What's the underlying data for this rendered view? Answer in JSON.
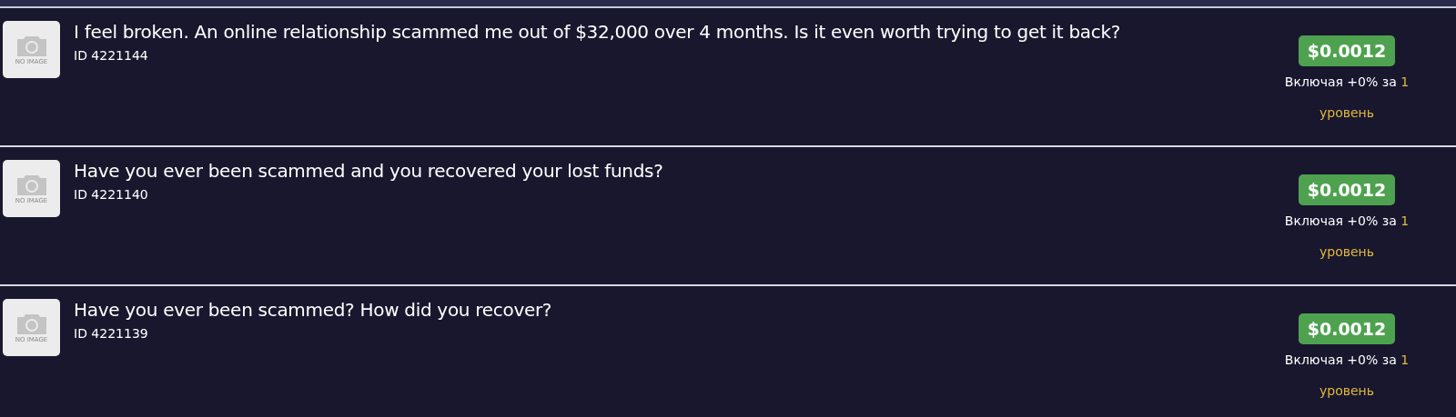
{
  "items": [
    {
      "thumb_text": "NO IMAGE",
      "title": "I feel broken. An online relationship scammed me out of $32,000 over 4 months. Is it even worth trying to get it back?",
      "id": "ID 4221144",
      "price": "$0.0012",
      "note": "Включая +0% за ",
      "level_text": "1 уровень"
    },
    {
      "thumb_text": "NO IMAGE",
      "title": "Have you ever been scammed and you recovered your lost funds?",
      "id": "ID 4221140",
      "price": "$0.0012",
      "note": "Включая +0% за ",
      "level_text": "1 уровень"
    },
    {
      "thumb_text": "NO IMAGE",
      "title": "Have you ever been scammed? How did you recover?",
      "id": "ID 4221139",
      "price": "$0.0012",
      "note": "Включая +0% за ",
      "level_text": "1 уровень"
    }
  ]
}
